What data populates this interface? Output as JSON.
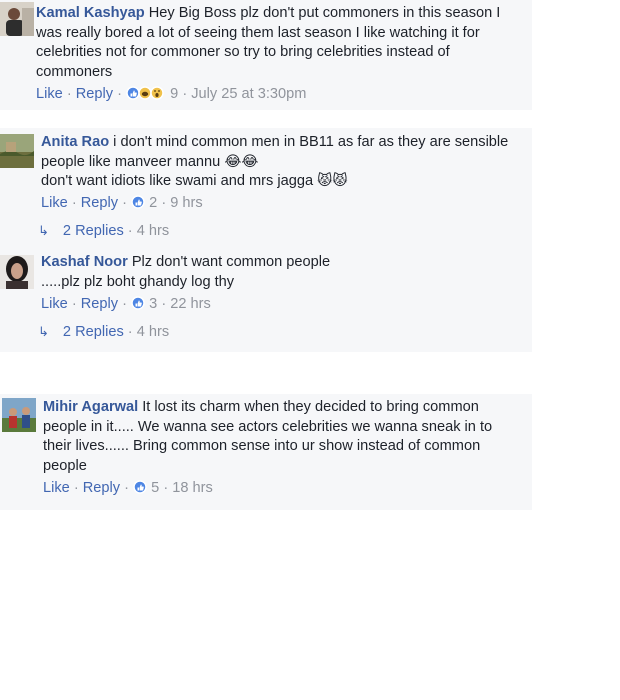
{
  "comments": [
    {
      "author": "Kamal Kashyap",
      "text": " Hey Big Boss plz don't put commoners in this season I was really bored a lot of seeing them last season I like watching it for celebrities not for commoner so try to bring celebrities instead of commoners",
      "like": "Like",
      "reply": "Reply",
      "reactions": "9",
      "time": "July 25 at 3:30pm"
    },
    {
      "author": "Anita Rao",
      "text": " i don't mind common men in BB11 as far as they are sensible people like manveer mannu 😂😂",
      "text2": "don't want idiots like swami and mrs jagga 😾😾",
      "like": "Like",
      "reply": "Reply",
      "reactions": "2",
      "time": "9 hrs",
      "replies_label": "2 Replies",
      "replies_time": "4 hrs"
    },
    {
      "author": "Kashaf Noor",
      "text": " Plz don't want common people",
      "text2": ".....plz plz boht ghandy log thy",
      "like": "Like",
      "reply": "Reply",
      "reactions": "3",
      "time": "22 hrs",
      "replies_label": "2 Replies",
      "replies_time": "4 hrs"
    },
    {
      "author": "Mihir Agarwal",
      "text": " It lost its charm when they decided to bring common people in it..... We wanna see actors celebrities we wanna sneak in to their lives...... Bring common sense into ur show instead of common people",
      "like": "Like",
      "reply": "Reply",
      "reactions": "5",
      "time": "18 hrs"
    }
  ],
  "colors": {
    "author": "#365899",
    "link": "#4267b2",
    "meta": "#90949c",
    "panel": "#f6f7f9"
  }
}
